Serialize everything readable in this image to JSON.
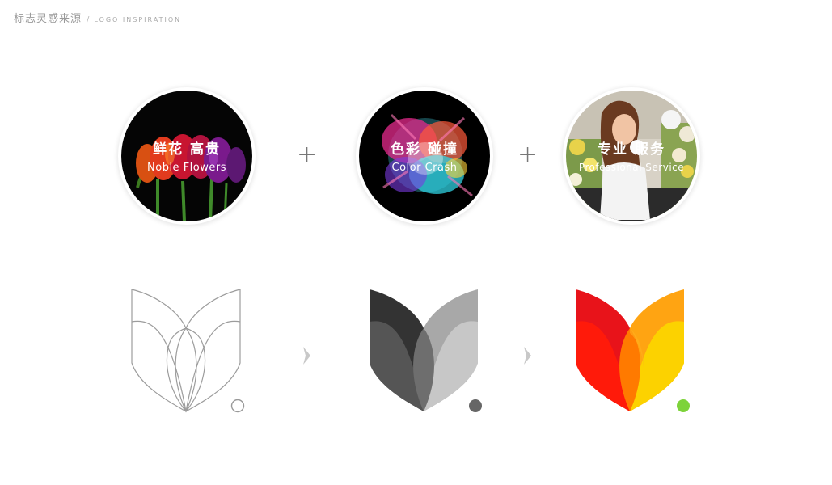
{
  "header": {
    "title": "标志灵感来源",
    "separator": "/",
    "subtitle": "LOGO INSPIRATION"
  },
  "inspirations": [
    {
      "title_cn": "鲜花 高贵",
      "title_en": "Noble Flowers"
    },
    {
      "title_cn": "色彩 碰撞",
      "title_en": "Color Crash"
    },
    {
      "title_cn": "专业 服务",
      "title_en": "Professional Service"
    }
  ],
  "operators": {
    "plus": "+"
  },
  "logo_stages": [
    {
      "style": "outline",
      "colors": [
        "#999999"
      ]
    },
    {
      "style": "grayscale",
      "colors": [
        "#333333",
        "#6a6a6a",
        "#9e9e9e",
        "#c4c4c4",
        "#666666"
      ]
    },
    {
      "style": "color",
      "colors": [
        "#e8131a",
        "#ff6a00",
        "#fbd100",
        "#ffa000",
        "#7dd33a"
      ]
    }
  ]
}
